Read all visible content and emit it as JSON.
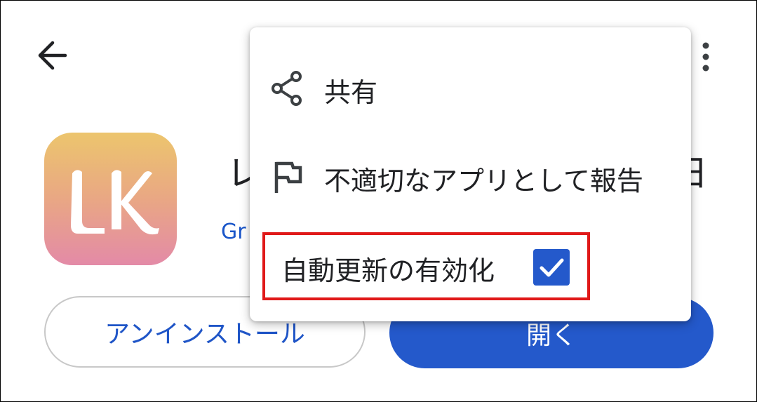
{
  "header": {
    "back_icon": "arrow-left-icon",
    "more_icon": "more-vert-icon"
  },
  "app": {
    "title_visible_start": "レ",
    "title_visible_end": "日",
    "developer_visible": "Gr",
    "icon_letters": "LK",
    "icon_colors": [
      "#ecc56d",
      "#e9a784",
      "#e38aa7"
    ]
  },
  "actions": {
    "uninstall_label": "アンインストール",
    "open_label": "開く"
  },
  "menu": {
    "items": [
      {
        "icon": "share-icon",
        "label": "共有"
      },
      {
        "icon": "flag-icon",
        "label": "不適切なアプリとして報告"
      }
    ],
    "auto_update": {
      "label": "自動更新の有効化",
      "checked": true,
      "highlight_color": "#e01919"
    }
  },
  "colors": {
    "accent": "#2459cb",
    "link": "#1a56c9"
  }
}
